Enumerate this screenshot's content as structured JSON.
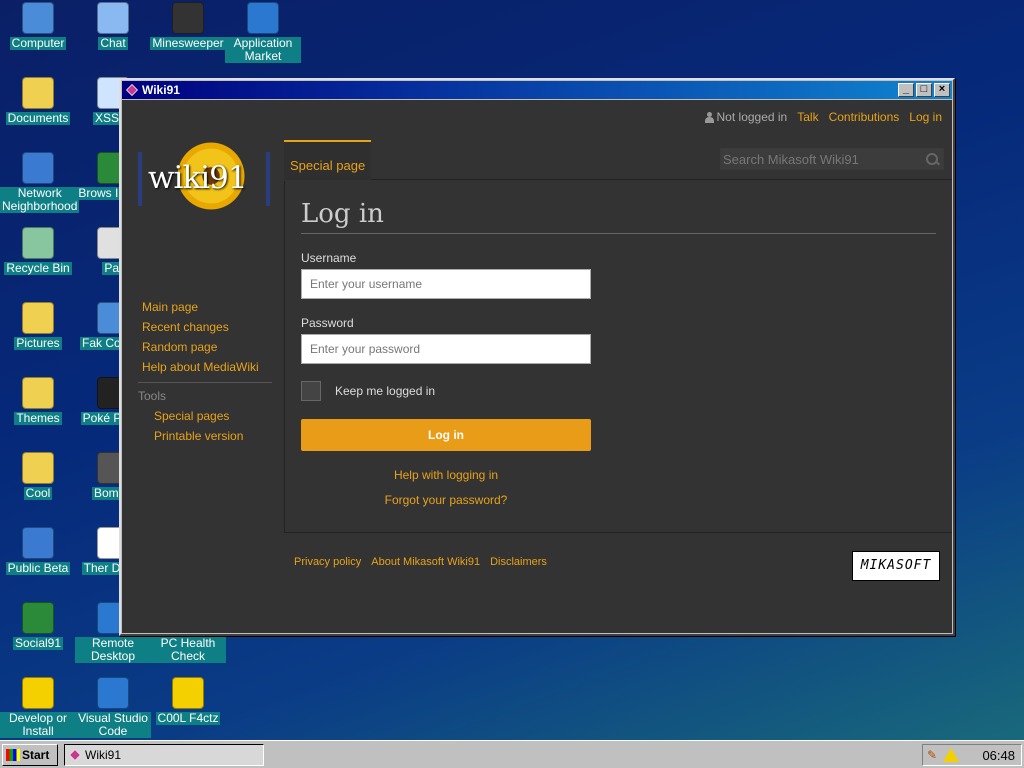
{
  "desktop": {
    "icons": [
      {
        "label": "Computer",
        "icon": "computer-icon",
        "color": "#4a8cd8"
      },
      {
        "label": "Chat",
        "icon": "chat-icon",
        "color": "#8ab8f0"
      },
      {
        "label": "Minesweeper",
        "icon": "mine-icon",
        "color": "#333333"
      },
      {
        "label": "Application Market",
        "icon": "market-icon",
        "color": "#2a78d0"
      },
      {
        "label": "Documents",
        "icon": "documents-folder-icon",
        "color": "#f0d050"
      },
      {
        "label": "XSS C",
        "icon": "xss-icon",
        "color": "#cfe4ff"
      },
      {
        "label": "Network Neighborhood",
        "icon": "network-icon",
        "color": "#3a7ad0"
      },
      {
        "label": "Brows Interw",
        "icon": "browser-icon",
        "color": "#2b8a3a"
      },
      {
        "label": "Recycle Bin",
        "icon": "recycle-bin-icon",
        "color": "#88c6a0"
      },
      {
        "label": "Pai",
        "icon": "paint-icon",
        "color": "#e0e0e0"
      },
      {
        "label": "Pictures",
        "icon": "pictures-folder-icon",
        "color": "#f0d050"
      },
      {
        "label": "Fak Compu",
        "icon": "fake-computer-icon",
        "color": "#4a8cd8"
      },
      {
        "label": "Themes",
        "icon": "themes-folder-icon",
        "color": "#f0d050"
      },
      {
        "label": "Poké Platin",
        "icon": "pokemon-icon",
        "color": "#222222"
      },
      {
        "label": "Cool",
        "icon": "cool-folder-icon",
        "color": "#f0d050"
      },
      {
        "label": "Bombe",
        "icon": "bomberman-icon",
        "color": "#555555"
      },
      {
        "label": "Public Beta",
        "icon": "public-beta-icon",
        "color": "#3a7ad0"
      },
      {
        "label": "Ther Desig",
        "icon": "theme-designer-icon",
        "color": "#ffffff"
      },
      {
        "label": "Social91",
        "icon": "social91-icon",
        "color": "#2b8a3a"
      },
      {
        "label": "Remote Desktop",
        "icon": "remote-desktop-icon",
        "color": "#2a78d0"
      },
      {
        "label": "PC Health Check",
        "icon": "pc-health-icon",
        "color": "#1a60b0"
      },
      {
        "label": "Develop or Install",
        "icon": "develop-install-icon",
        "color": "#f5d000"
      },
      {
        "label": "Visual Studio Code",
        "icon": "vscode-icon",
        "color": "#2a78d0"
      },
      {
        "label": "C00L F4ctz",
        "icon": "cool-facts-icon",
        "color": "#f5d000"
      }
    ]
  },
  "window": {
    "title": "Wiki91",
    "min_label": "_",
    "max_label": "□",
    "close_label": "×"
  },
  "wiki": {
    "personal": {
      "not_logged_in": "Not logged in",
      "talk": "Talk",
      "contributions": "Contributions",
      "login": "Log in"
    },
    "logo_text": "wiki91",
    "nav": {
      "main_page": "Main page",
      "recent_changes": "Recent changes",
      "random_page": "Random page",
      "help": "Help about MediaWiki",
      "tools_heading": "Tools",
      "special_pages": "Special pages",
      "printable": "Printable version"
    },
    "tab_special": "Special page",
    "search_placeholder": "Search Mikasoft Wiki91",
    "page_title": "Log in",
    "form": {
      "username_label": "Username",
      "username_placeholder": "Enter your username",
      "password_label": "Password",
      "password_placeholder": "Enter your password",
      "keep_logged": "Keep me logged in",
      "submit": "Log in",
      "help_link": "Help with logging in",
      "forgot_link": "Forgot your password?"
    },
    "footer": {
      "privacy": "Privacy policy",
      "about": "About Mikasoft Wiki91",
      "disclaimers": "Disclaimers"
    },
    "brand_badge": "MIKASOFT"
  },
  "taskbar": {
    "start": "Start",
    "task_title": "Wiki91",
    "clock": "06:48"
  },
  "colors": {
    "accent": "#e8a21a",
    "wiki_bg": "#333333",
    "button": "#e89c17",
    "title_bar": "#000080"
  }
}
